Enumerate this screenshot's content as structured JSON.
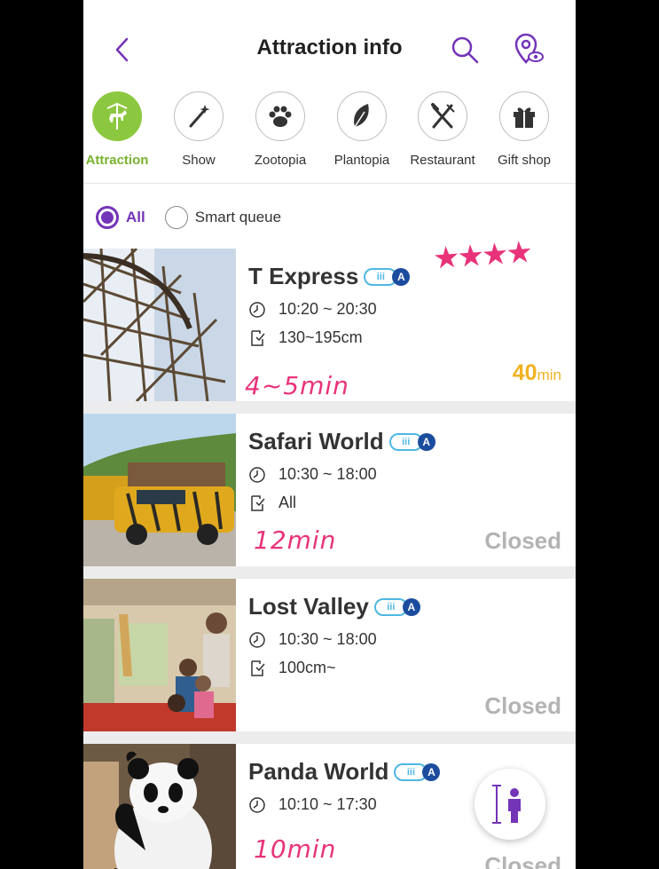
{
  "header": {
    "title": "Attraction info"
  },
  "categories": [
    {
      "label": "Attraction",
      "icon": "carousel-horse-icon",
      "active": true
    },
    {
      "label": "Show",
      "icon": "magic-wand-icon"
    },
    {
      "label": "Zootopia",
      "icon": "paw-icon"
    },
    {
      "label": "Plantopia",
      "icon": "leaf-icon"
    },
    {
      "label": "Restaurant",
      "icon": "fork-knife-icon"
    },
    {
      "label": "Gift shop",
      "icon": "gift-icon"
    }
  ],
  "filters": {
    "all": "All",
    "smart_queue": "Smart queue",
    "selected": "All"
  },
  "accent": "#7434b8",
  "green": "#8cc83f",
  "badge_text": {
    "pill": "iii",
    "letter": "A"
  },
  "attractions": [
    {
      "name": "T Express",
      "hours": "10:20 ~ 20:30",
      "restriction": "130~195cm",
      "wait_value": "40",
      "wait_unit": "min",
      "note": "4~5min",
      "stars": "★★★★"
    },
    {
      "name": "Safari World",
      "hours": "10:30 ~ 18:00",
      "restriction": "All",
      "status": "Closed",
      "note": "12min"
    },
    {
      "name": "Lost Valley",
      "hours": "10:30 ~ 18:00",
      "restriction": "100cm~",
      "status": "Closed"
    },
    {
      "name": "Panda World",
      "hours": "10:10 ~ 17:30",
      "status": "Closed",
      "note": "10min"
    }
  ]
}
